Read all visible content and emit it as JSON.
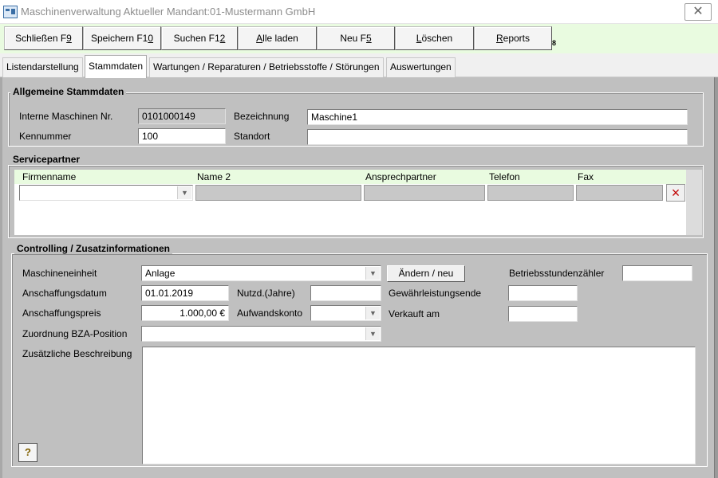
{
  "window": {
    "title": "Maschinenverwaltung Aktueller Mandant:01-Mustermann GmbH",
    "close_glyph": "✕"
  },
  "toolbar": {
    "buttons": [
      {
        "name": "schliessen-button",
        "prefix": "Schließen F",
        "accel": "9",
        "suffix": ""
      },
      {
        "name": "speichern-button",
        "prefix": "Speichern F1",
        "accel": "0",
        "suffix": ""
      },
      {
        "name": "suchen-button",
        "prefix": "Suchen F1",
        "accel": "2",
        "suffix": ""
      },
      {
        "name": "alle-laden-button",
        "prefix": "",
        "accel": "A",
        "suffix": "lle laden"
      },
      {
        "name": "neu-button",
        "prefix": "Neu F",
        "accel": "5",
        "suffix": ""
      },
      {
        "name": "loeschen-button",
        "prefix": "",
        "accel": "L",
        "suffix": "öschen"
      },
      {
        "name": "reports-button",
        "prefix": "",
        "accel": "R",
        "suffix": "eports"
      }
    ],
    "mark": "8"
  },
  "tabs": [
    {
      "label": "Listendarstellung",
      "active": false
    },
    {
      "label": "Stammdaten",
      "active": true
    },
    {
      "label": "Wartungen / Reparaturen / Betriebsstoffe / Störungen",
      "active": false
    },
    {
      "label": "Auswertungen",
      "active": false
    }
  ],
  "allgemein": {
    "title": "Allgemeine Stammdaten",
    "interne_nr_label": "Interne Maschinen Nr.",
    "interne_nr_value": "0101000149",
    "bezeichnung_label": "Bezeichnung",
    "bezeichnung_value": "Maschine1",
    "kennummer_label": "Kennummer",
    "kennummer_value": "100",
    "standort_label": "Standort",
    "standort_value": ""
  },
  "servicepartner": {
    "title": "Servicepartner",
    "columns": [
      "Firmenname",
      "Name 2",
      "Ansprechpartner",
      "Telefon",
      "Fax"
    ],
    "delete_icon": "×"
  },
  "controlling": {
    "title": "Controlling / Zusatzinformationen",
    "maschineneinheit_label": "Maschineneinheit",
    "maschineneinheit_value": "Anlage",
    "aendern_button": "Ändern / neu",
    "betriebsstunden_label": "Betriebsstundenzähler",
    "betriebsstunden_value": "",
    "anschaffungsdatum_label": "Anschaffungsdatum",
    "anschaffungsdatum_value": "01.01.2019",
    "nutzd_label": "Nutzd.(Jahre)",
    "nutzd_value": "",
    "gewaehrleistung_label": "Gewährleistungsende",
    "gewaehrleistung_value": "",
    "anschaffungspreis_label": "Anschaffungspreis",
    "anschaffungspreis_value": "1.000,00 €",
    "aufwandskonto_label": "Aufwandskonto",
    "aufwandskonto_value": "",
    "verkauft_label": "Verkauft am",
    "verkauft_value": "",
    "bza_label": "Zuordnung BZA-Position",
    "bza_value": "",
    "beschreibung_label": "Zusätzliche Beschreibung",
    "beschreibung_value": "",
    "help_glyph": "?"
  }
}
